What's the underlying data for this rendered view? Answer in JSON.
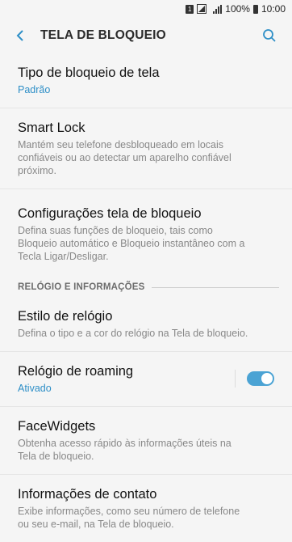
{
  "status_bar": {
    "sim": "1",
    "battery": "100%",
    "time": "10:00"
  },
  "app_bar": {
    "title": "TELA DE BLOQUEIO",
    "back_icon": "back-arrow-icon",
    "search_icon": "search-icon"
  },
  "items": [
    {
      "title": "Tipo de bloqueio de tela",
      "subtitle": "Padrão"
    },
    {
      "title": "Smart Lock",
      "subtitle": "Mantém seu telefone desbloqueado em locais confiáveis ou ao detectar um aparelho confiável próximo."
    },
    {
      "title": "Configurações tela de bloqueio",
      "subtitle": "Defina suas funções de bloqueio, tais como Bloqueio automático e Bloqueio instantâneo com a Tecla Ligar/Desligar."
    }
  ],
  "section": {
    "header": "RELÓGIO E INFORMAÇÕES"
  },
  "section_items": [
    {
      "title": "Estilo de relógio",
      "subtitle": "Defina o tipo e a cor do relógio na Tela de bloqueio."
    },
    {
      "title": "Relógio de roaming",
      "subtitle": "Ativado",
      "toggle_on": true
    },
    {
      "title": "FaceWidgets",
      "subtitle": "Obtenha acesso rápido às informações úteis na Tela de bloqueio."
    },
    {
      "title": "Informações de contato",
      "subtitle": "Exibe informações, como seu número de telefone ou seu e-mail, na Tela de bloqueio."
    }
  ],
  "colors": {
    "accent": "#2e8fc7",
    "toggle": "#4ba3d4"
  }
}
